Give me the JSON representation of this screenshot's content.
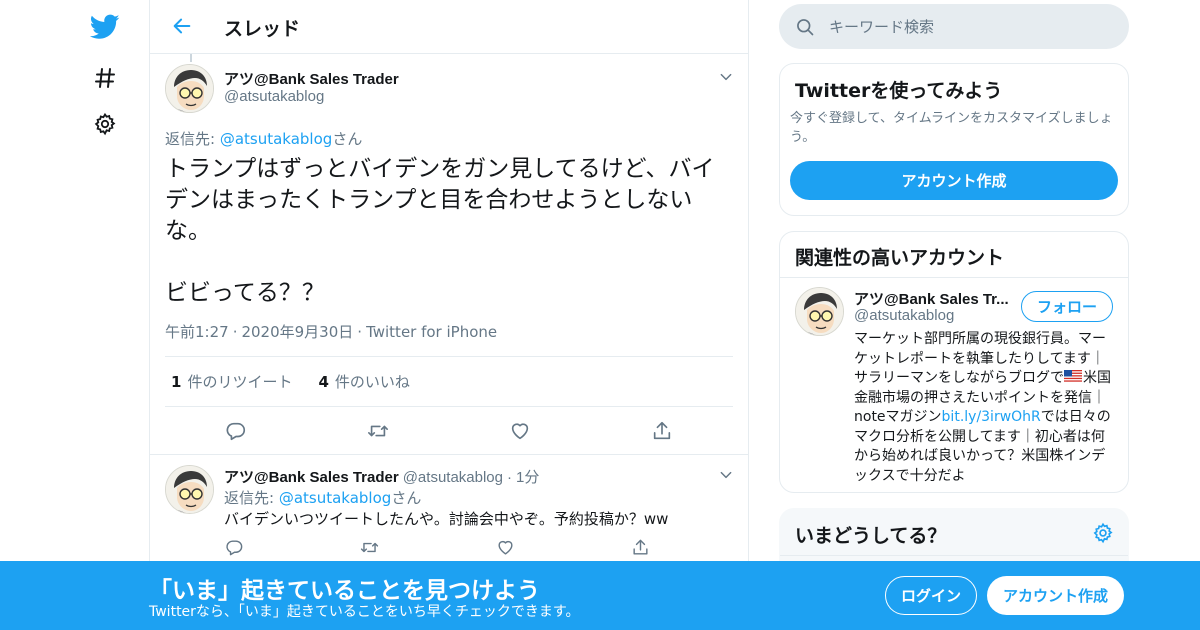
{
  "colors": {
    "accent": "#1da1f2",
    "text": "#14171a",
    "secondary": "#657786",
    "border": "#e6ecf0"
  },
  "nav": {
    "icons": [
      "twitter-bird-icon",
      "hashtag-icon",
      "gear-icon"
    ]
  },
  "thread": {
    "title": "スレッド"
  },
  "main_tweet": {
    "name": "アツ@Bank Sales Trader",
    "handle": "@atsutakablog",
    "reply_prefix": "返信先: ",
    "reply_mention": "@atsutakablog",
    "reply_suffix": "さん",
    "text": "トランプはずっとバイデンをガン見してるけど、バイデンはまったくトランプと目を合わせようとしないな。\n\nビビってる？？",
    "time": "午前1:27",
    "date": "2020年9月30日",
    "source": "Twitter for iPhone",
    "retweet_count": "1",
    "retweet_label": "件のリツイート",
    "like_count": "4",
    "like_label": "件のいいね"
  },
  "reply_tweet": {
    "name": "アツ@Bank Sales Trader",
    "handle": "@atsutakablog",
    "dot": "·",
    "age": "1分",
    "reply_prefix": "返信先: ",
    "reply_mention": "@atsutakablog",
    "reply_suffix": "さん",
    "text": "バイデンいつツイートしたんや。討論会中やぞ。予約投稿か？ww"
  },
  "search": {
    "placeholder": "キーワード検索"
  },
  "signup_card": {
    "title": "Twitterを使ってみよう",
    "description": "今すぐ登録して、タイムラインをカスタマイズしましょう。",
    "button": "アカウント作成"
  },
  "related": {
    "title": "関連性の高いアカウント",
    "name": "アツ@Bank Sales Tr...",
    "handle": "@atsutakablog",
    "follow": "フォロー",
    "bio_1": "マーケット部門所属の現役銀行員。マーケットレポートを執筆したりしてます｜サラリーマンをしながらブログで",
    "bio_flag": "us-flag-icon",
    "bio_2": "米国金融市場の押さえたいポイントを発信｜noteマガジン",
    "bio_link": "bit.ly/3irwOhR",
    "bio_3": "では日々のマクロ分析を公開してます｜初心者は何から始めれば良いかって？米国株インデックスで十分だよ"
  },
  "trends": {
    "title": "いまどうしてる？"
  },
  "bottom_bar": {
    "title": "「いま」起きていることを見つけよう",
    "subtitle": "Twitterなら、「いま」起きていることをいち早くチェックできます。",
    "login": "ログイン",
    "signup": "アカウント作成"
  }
}
